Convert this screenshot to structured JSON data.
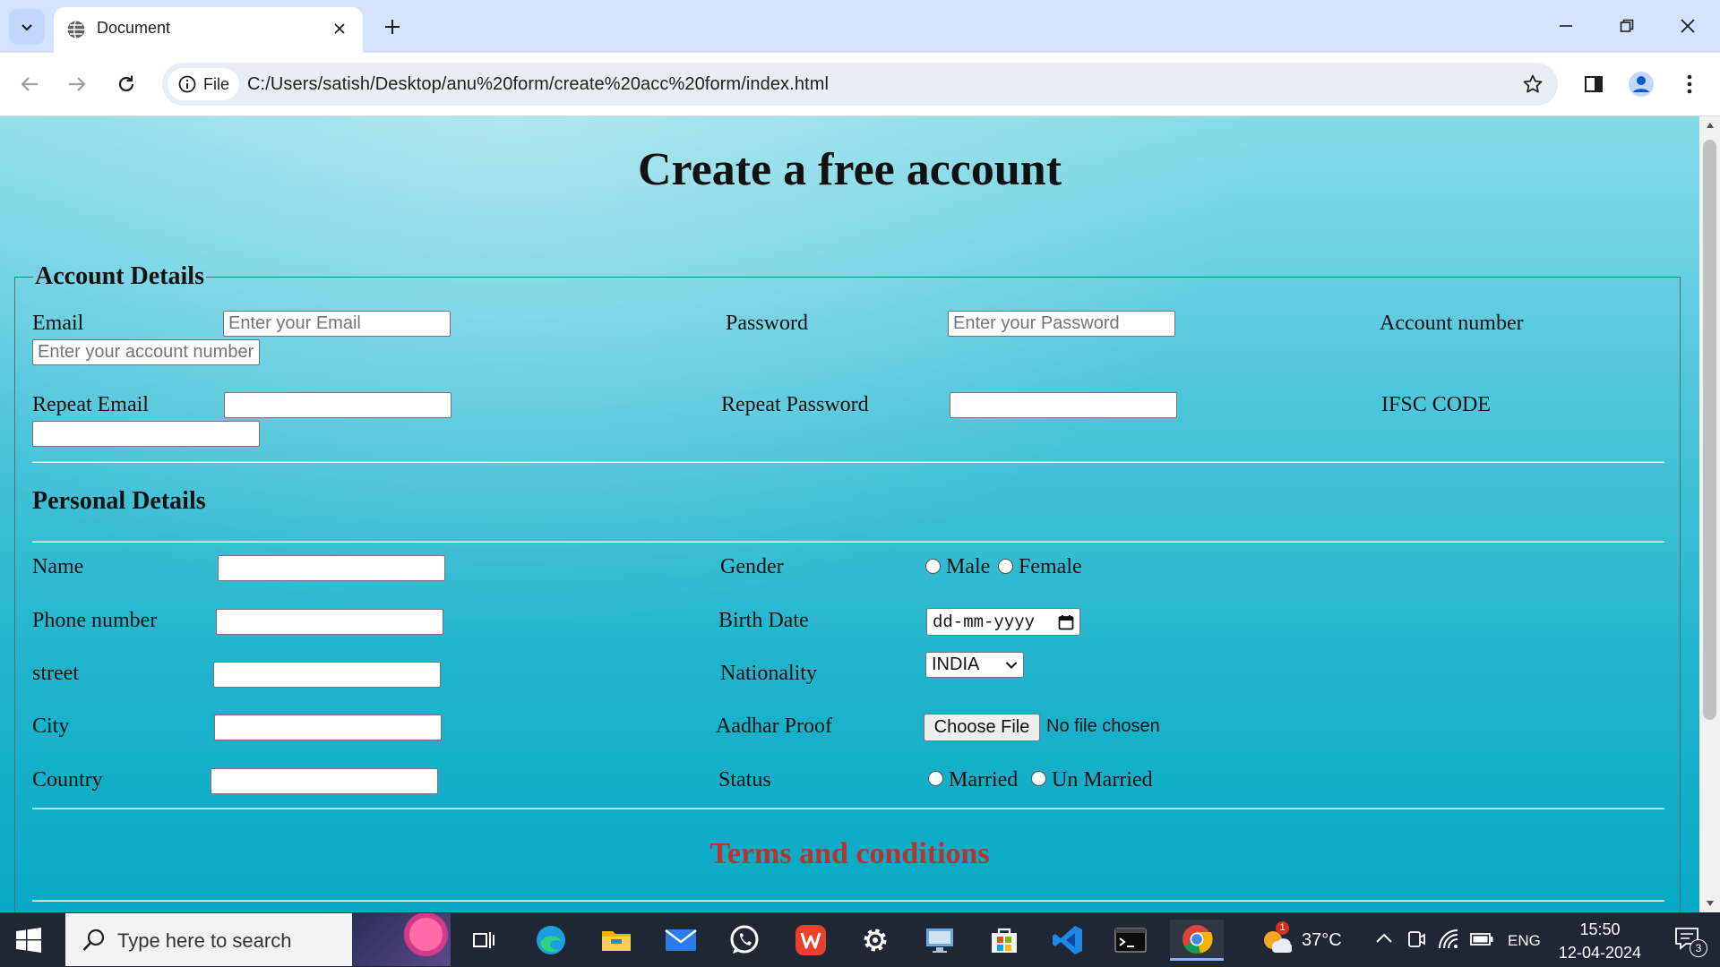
{
  "browser": {
    "tab_title": "Document",
    "site_chip_label": "File",
    "url": "C:/Users/satish/Desktop/anu%20form/create%20acc%20form/index.html"
  },
  "page": {
    "title": "Create a free account",
    "account_section": {
      "legend": "Account Details",
      "email_label": "Email",
      "email_placeholder": "Enter your Email",
      "password_label": "Password",
      "password_placeholder": "Enter your Password",
      "account_number_label": "Account number",
      "account_number_placeholder": "Enter your account number",
      "repeat_email_label": "Repeat Email",
      "repeat_password_label": "Repeat Password",
      "ifsc_label": "IFSC CODE"
    },
    "personal_section": {
      "heading": "Personal Details",
      "name_label": "Name",
      "phone_label": "Phone number",
      "street_label": "street",
      "city_label": "City",
      "country_label": "Country",
      "gender_label": "Gender",
      "gender_options": [
        "Male",
        "Female"
      ],
      "birth_date_label": "Birth Date",
      "birth_date_placeholder": "dd-mm-yyyy",
      "nationality_label": "Nationality",
      "nationality_selected": "INDIA",
      "aadhar_label": "Aadhar Proof",
      "file_button": "Choose File",
      "file_status": "No file chosen",
      "status_label": "Status",
      "status_options": [
        "Married",
        "Un Married"
      ]
    },
    "terms_heading": "Terms and conditions",
    "terms_color": "#b8322f"
  },
  "taskbar": {
    "search_placeholder": "Type here to search",
    "weather_temp": "37°C",
    "weather_badge": "1",
    "language": "ENG",
    "time": "15:50",
    "date": "12-04-2024",
    "notification_count": "3",
    "apps": [
      "task-view",
      "edge",
      "file-explorer",
      "mail",
      "whatsapp",
      "wps-office",
      "settings",
      "remote-desktop",
      "microsoft-store",
      "vscode",
      "terminal",
      "chrome"
    ]
  }
}
